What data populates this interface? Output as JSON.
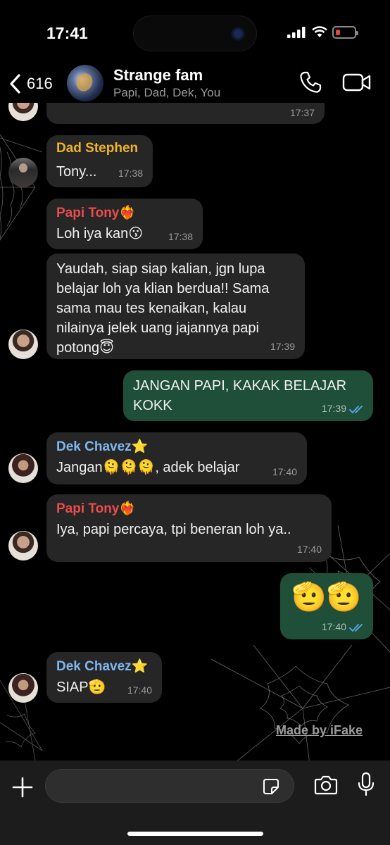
{
  "status_bar": {
    "time": "17:41"
  },
  "header": {
    "back_count": "616",
    "group_name": "Strange fam",
    "members": "Papi, Dad, Dek, You"
  },
  "messages": [
    {
      "id": "m0",
      "time": "17:37"
    },
    {
      "id": "m1",
      "sender": "Dad Stephen",
      "text": "Tony...",
      "time": "17:38"
    },
    {
      "id": "m2",
      "sender": "Papi Tony❤️‍🔥",
      "text": "Loh iya kan😗",
      "time": "17:38"
    },
    {
      "id": "m3",
      "lines": [
        "Yaudah, siap siap kalian, jgn lupa",
        "belajar loh ya klian berdua!! Sama",
        "sama mau tes kenaikan, kalau",
        "nilainya jelek uang jajannya papi",
        "potong😇"
      ],
      "time": "17:39"
    },
    {
      "id": "m4",
      "lines": [
        "JANGAN PAPI, KAKAK BELAJAR",
        "KOKK"
      ],
      "time": "17:39"
    },
    {
      "id": "m5",
      "sender": "Dek Chavez⭐",
      "text": "Jangan🫠🫠🫠, adek belajar",
      "time": "17:40"
    },
    {
      "id": "m6",
      "sender": "Papi Tony❤️‍🔥",
      "text": "Iya, papi percaya, tpi beneran loh ya..",
      "time": "17:40"
    },
    {
      "id": "m7",
      "text": "🫡🫡",
      "time": "17:40"
    },
    {
      "id": "m8",
      "sender": "Dek Chavez⭐",
      "text": "SIAP🫡",
      "time": "17:40"
    }
  ],
  "colors": {
    "sender_dad": "#f0b429",
    "sender_papi": "#ec4c4c",
    "sender_dek": "#7fb8f0",
    "bubble_in": "#262626",
    "bubble_out": "#1f4f38",
    "read_ticks": "#5aa9f0"
  },
  "watermark": "Made by iFake",
  "icons": [
    "chevron-left-icon",
    "phone-icon",
    "video-camera-icon",
    "plus-icon",
    "sticker-icon",
    "camera-icon",
    "microphone-icon"
  ]
}
